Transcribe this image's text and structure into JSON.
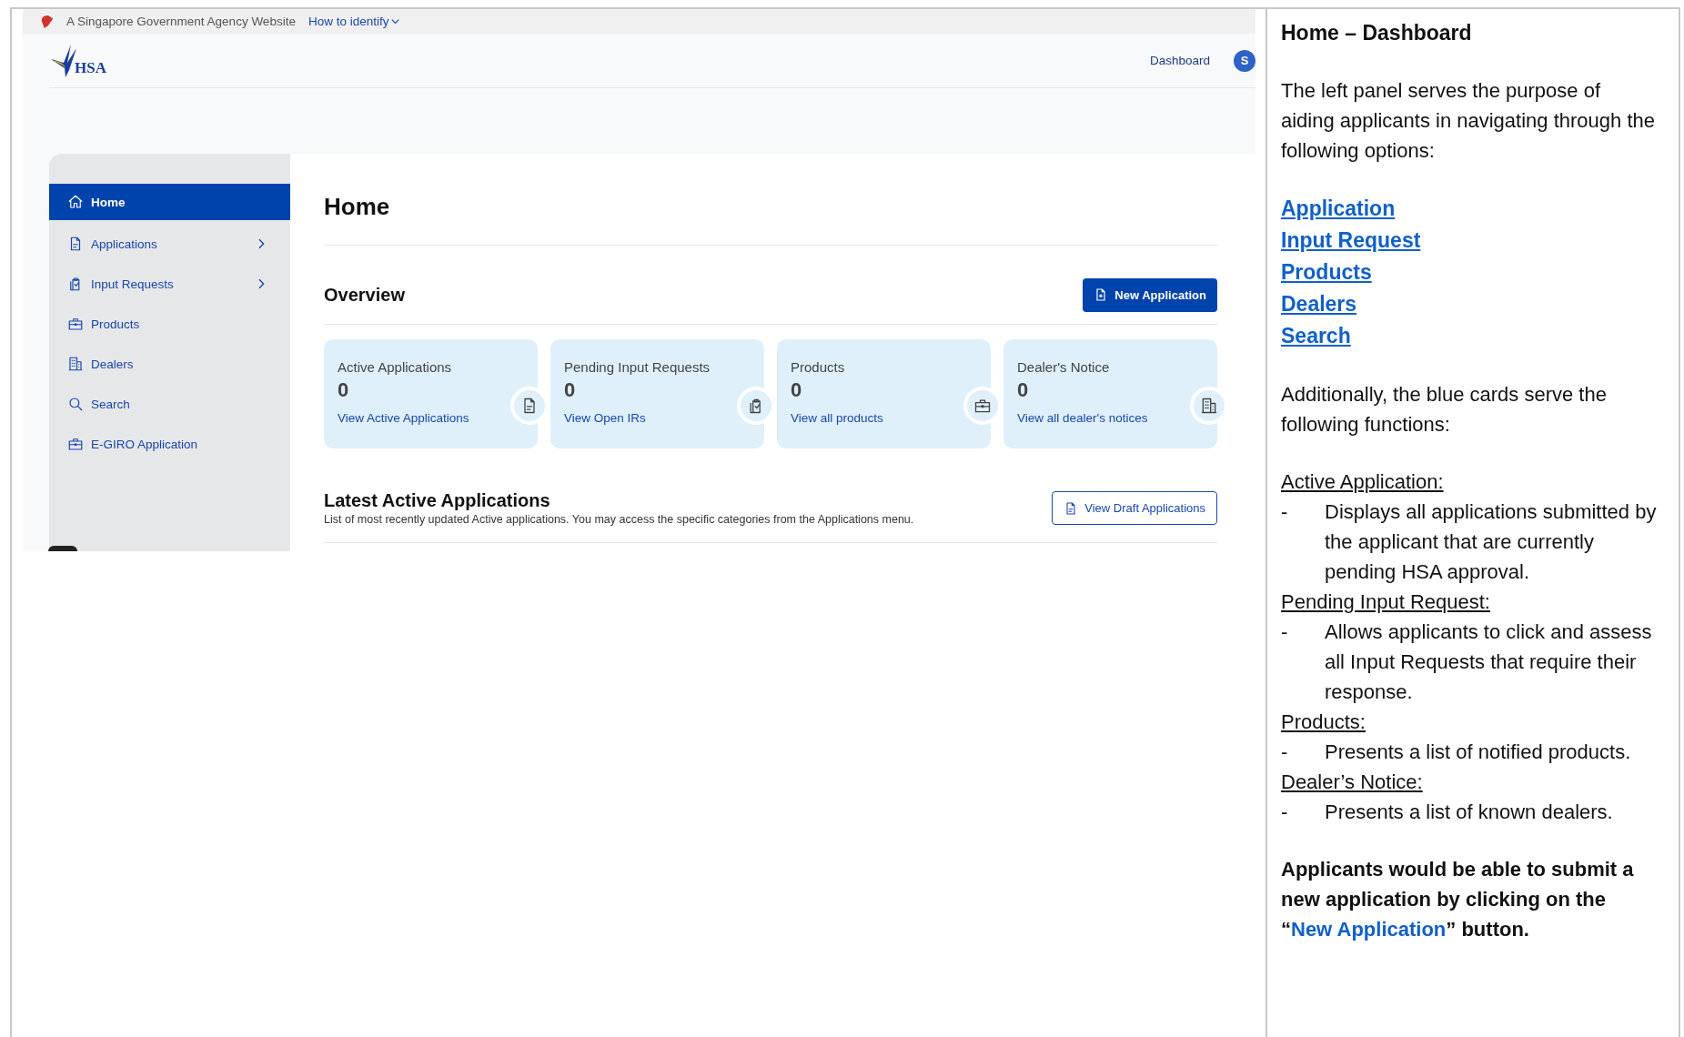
{
  "gov_bar": {
    "text": "A Singapore Government Agency Website",
    "link": "How to identify"
  },
  "header": {
    "logo_text": "HSA",
    "nav_link": "Dashboard",
    "avatar_initial": "S"
  },
  "sidebar": {
    "items": [
      {
        "label": "Home",
        "kind": "home",
        "selected": true,
        "has_submenu": false
      },
      {
        "label": "Applications",
        "kind": "document",
        "selected": false,
        "has_submenu": true
      },
      {
        "label": "Input Requests",
        "kind": "clipboard",
        "selected": false,
        "has_submenu": true
      },
      {
        "label": "Products",
        "kind": "briefcase",
        "selected": false,
        "has_submenu": false
      },
      {
        "label": "Dealers",
        "kind": "building",
        "selected": false,
        "has_submenu": false
      },
      {
        "label": "Search",
        "kind": "search",
        "selected": false,
        "has_submenu": false
      },
      {
        "label": "E-GIRO Application",
        "kind": "briefcase",
        "selected": false,
        "has_submenu": false
      }
    ]
  },
  "main": {
    "title": "Home",
    "overview": {
      "title": "Overview",
      "button": "New Application",
      "cards": [
        {
          "label": "Active Applications",
          "count": "0",
          "link": "View Active Applications",
          "kind": "document"
        },
        {
          "label": "Pending Input Requests",
          "count": "0",
          "link": "View Open IRs",
          "kind": "clipboard"
        },
        {
          "label": "Products",
          "count": "0",
          "link": "View all products",
          "kind": "briefcase"
        },
        {
          "label": "Dealer's Notice",
          "count": "0",
          "link": "View all dealer's notices",
          "kind": "building"
        }
      ]
    },
    "latest": {
      "title": "Latest Active Applications",
      "description": "List of most recently updated Active applications. You may access the specific categories from the Applications menu.",
      "button": "View Draft Applications"
    }
  },
  "notes": {
    "title": "Home – Dashboard",
    "intro": "The left panel serves the purpose of aiding applicants in navigating through the following options:",
    "links": [
      "Application",
      "Input Request",
      "Products",
      "Dealers",
      "Search"
    ],
    "cards_intro": "Additionally, the blue cards serve the following functions:",
    "functions": [
      {
        "heading": "Active Application:",
        "bullet": "-",
        "point": "Displays all applications submitted by the applicant that are currently pending HSA approval."
      },
      {
        "heading": "Pending Input Request:",
        "bullet": "-",
        "point": "Allows applicants to click and assess all Input Requests that require their response."
      },
      {
        "heading": "Products:",
        "bullet": "-",
        "point": "Presents a list of notified products."
      },
      {
        "heading": "Dealer’s Notice:",
        "bullet": "-",
        "point": "Presents a list of known dealers."
      }
    ],
    "closing": {
      "before": "Applicants would be able to submit a new application by clicking on the “",
      "link": "New Application",
      "after": "” button."
    }
  }
}
